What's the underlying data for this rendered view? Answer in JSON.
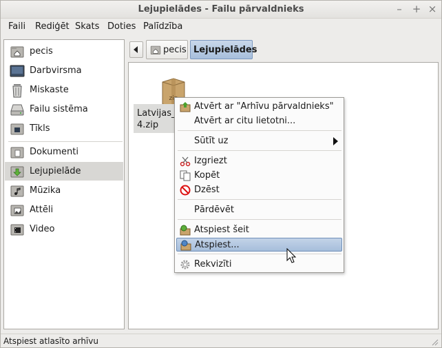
{
  "window": {
    "title": "Lejupielādes - Failu pārvaldnieks",
    "controls": {
      "minimize": "–",
      "maximize": "+",
      "close": "×"
    }
  },
  "menubar": [
    {
      "label": "Faili",
      "icon": ""
    },
    {
      "label": "Rediģēt"
    },
    {
      "label": "Skats"
    },
    {
      "label": "Doties"
    },
    {
      "label": "Palīdzība"
    }
  ],
  "sidebar": {
    "places": [
      {
        "label": "pecis",
        "icon": "home-folder-icon"
      },
      {
        "label": "Darbvirsma",
        "icon": "desktop-icon"
      },
      {
        "label": "Miskaste",
        "icon": "trash-icon"
      },
      {
        "label": "Failu sistēma",
        "icon": "harddisk-icon"
      },
      {
        "label": "Tīkls",
        "icon": "network-icon"
      }
    ],
    "bookmarks": [
      {
        "label": "Dokumenti",
        "icon": "documents-folder-icon"
      },
      {
        "label": "Lejupielāde",
        "icon": "downloads-folder-icon",
        "selected": true
      },
      {
        "label": "Mūzika",
        "icon": "music-folder-icon"
      },
      {
        "label": "Attēli",
        "icon": "pictures-folder-icon"
      },
      {
        "label": "Video",
        "icon": "videos-folder-icon"
      }
    ]
  },
  "pathbar": {
    "crumbs": [
      {
        "label": "pecis",
        "icon": "home-folder-icon"
      },
      {
        "label": "Lejupielādes",
        "active": true
      }
    ]
  },
  "main": {
    "file": {
      "name_line1": "Latvijas_D",
      "name_line2": "4.zip",
      "icon_text": "zip"
    }
  },
  "context_menu": {
    "items": [
      {
        "label": "Atvērt ar \"Arhīvu pārvaldnieks\"",
        "icon": "archive-manager-icon"
      },
      {
        "label": "Atvērt ar citu lietotni...",
        "icon": ""
      },
      {
        "label": "Sūtīt uz",
        "icon": "",
        "submenu": true
      },
      {
        "label": "Izgriezt",
        "icon": "scissors-icon"
      },
      {
        "label": "Kopēt",
        "icon": "copy-icon"
      },
      {
        "label": "Dzēst",
        "icon": "delete-icon"
      },
      {
        "label": "Pārdēvēt",
        "icon": ""
      },
      {
        "label": "Atspiest šeit",
        "icon": "extract-here-icon"
      },
      {
        "label": "Atspiest...",
        "icon": "extract-icon",
        "highlighted": true
      },
      {
        "label": "Rekvizīti",
        "icon": "properties-gear-icon"
      }
    ]
  },
  "statusbar": {
    "text": "Atspiest atlasīto arhīvu"
  },
  "colors": {
    "highlight": "#a6bedb",
    "selection": "#d8d7d4",
    "active_crumb": "#a7bfdc"
  }
}
